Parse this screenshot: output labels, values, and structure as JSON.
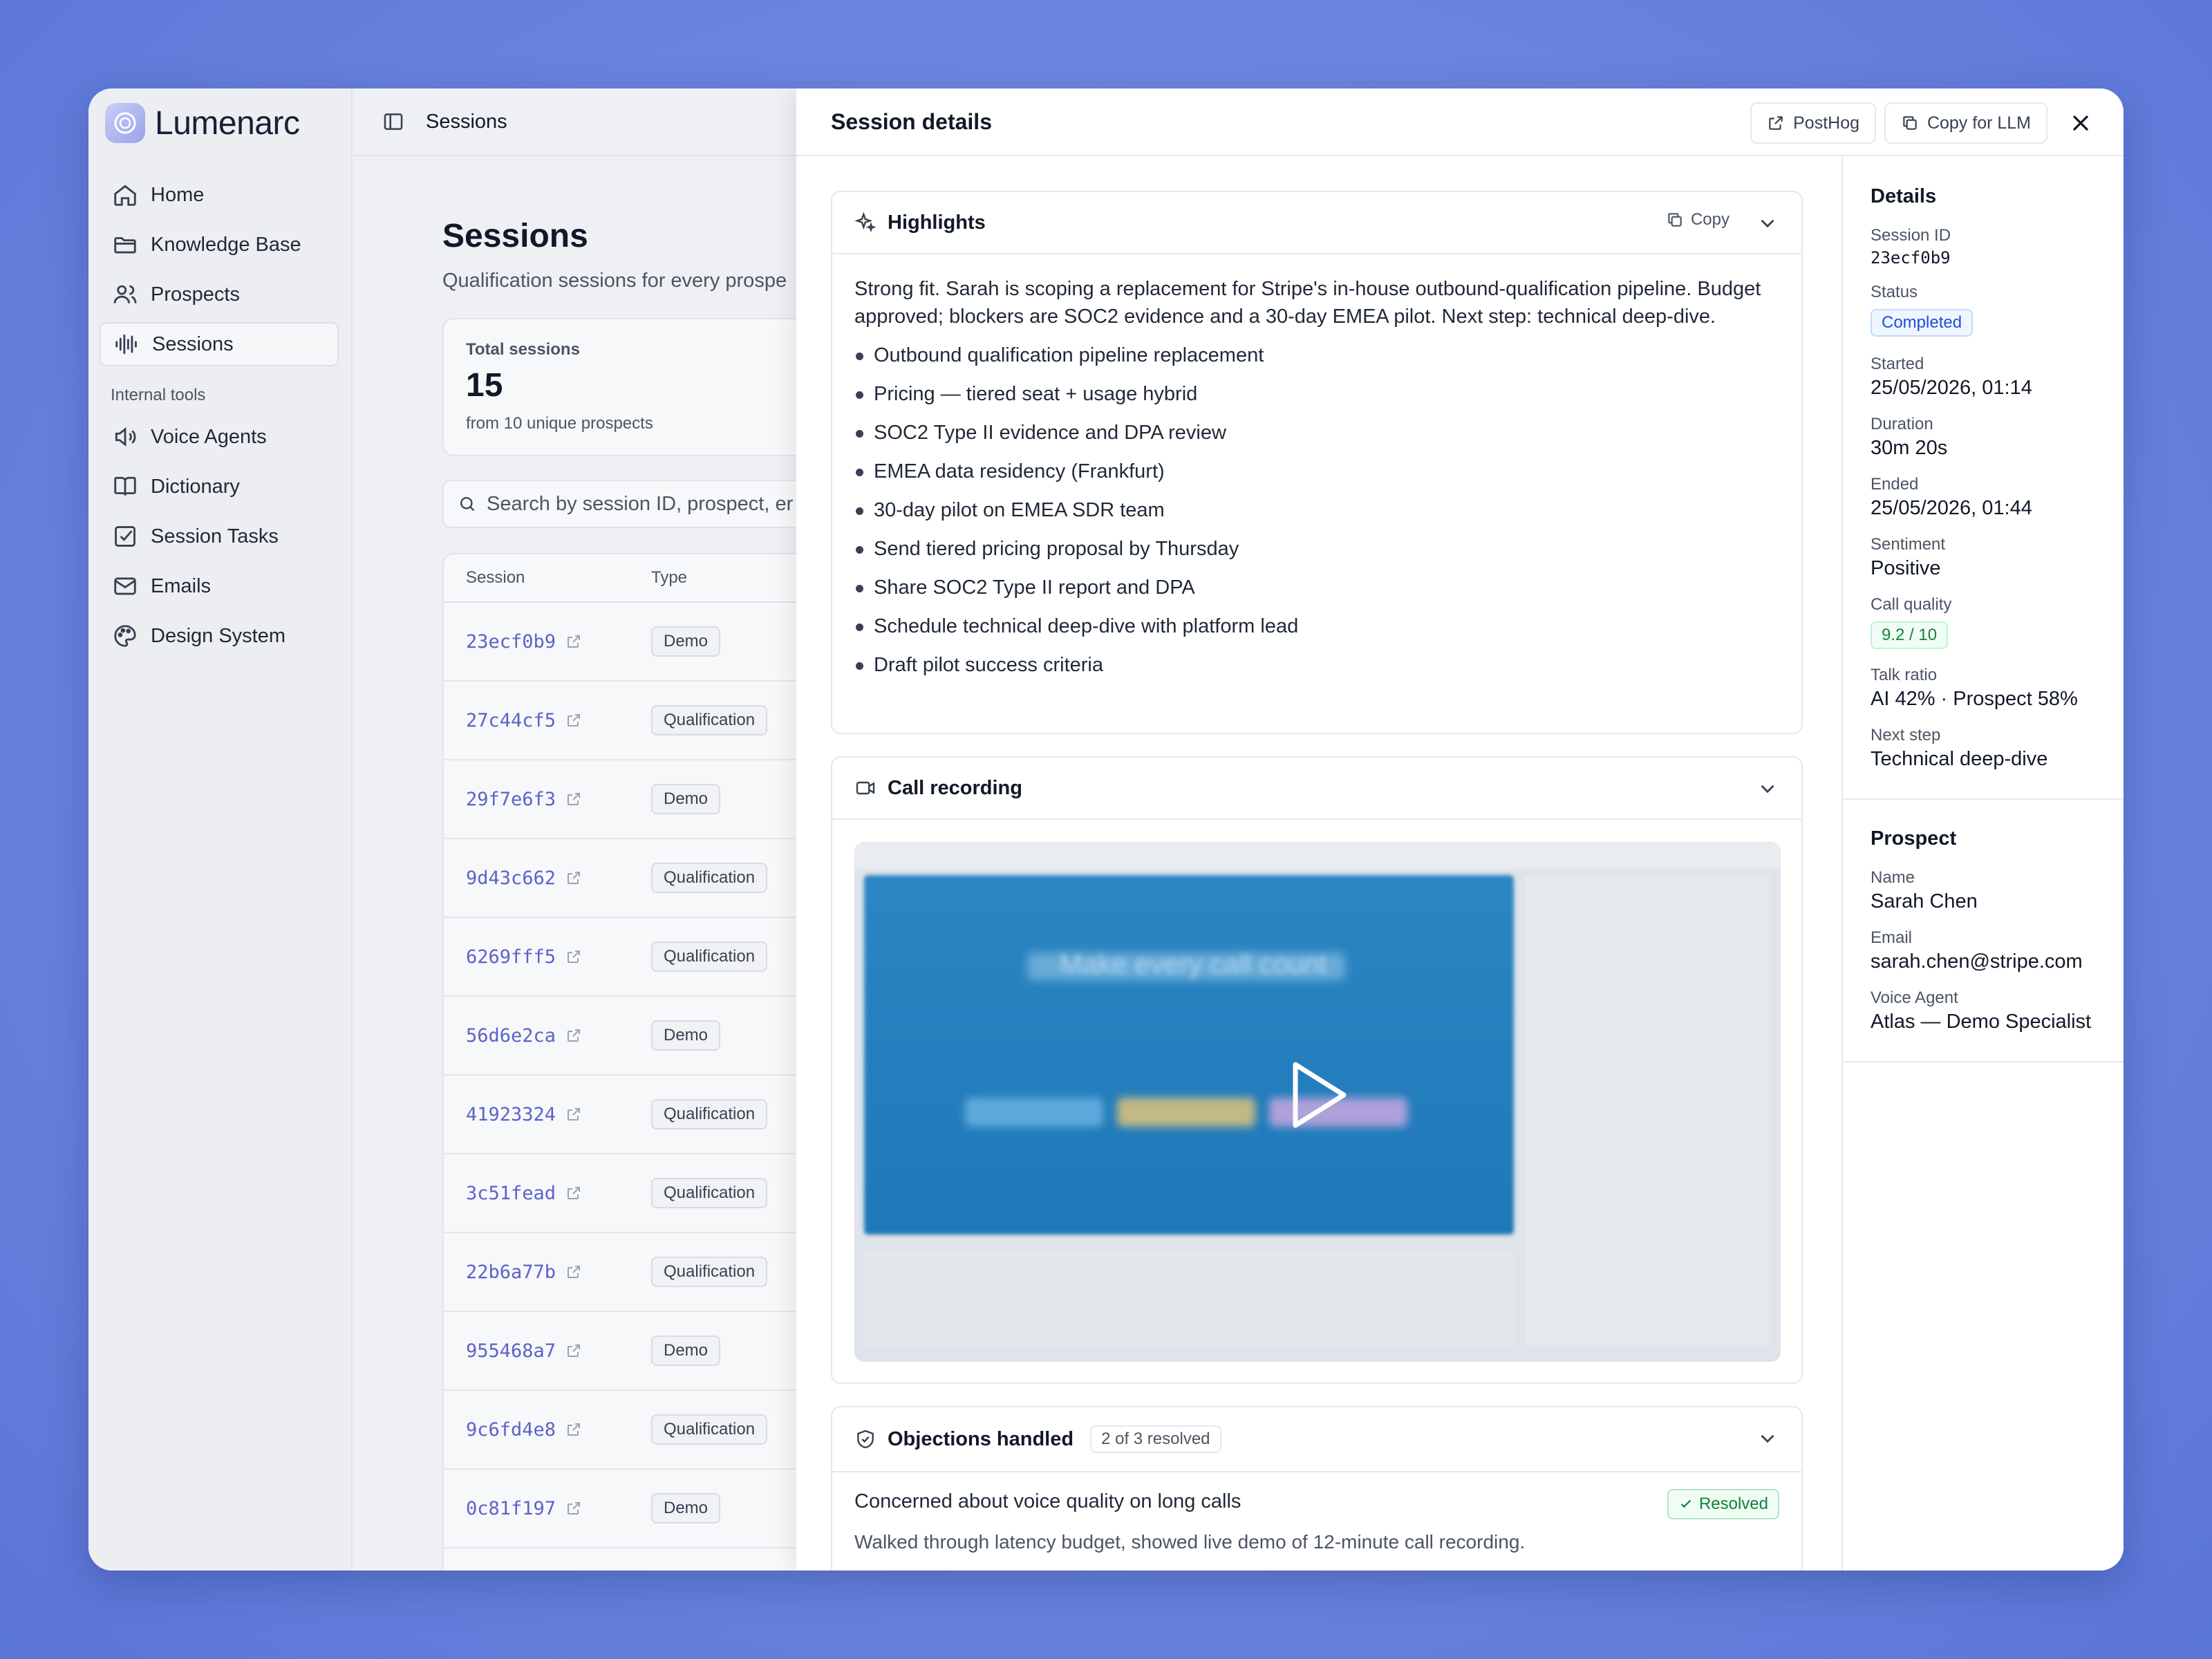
{
  "app": {
    "name": "Lumenarc"
  },
  "sidebar": {
    "items": [
      {
        "label": "Home",
        "icon": "home-icon"
      },
      {
        "label": "Knowledge Base",
        "icon": "folder-icon"
      },
      {
        "label": "Prospects",
        "icon": "users-icon"
      },
      {
        "label": "Sessions",
        "icon": "waveform-icon",
        "active": true
      }
    ],
    "section_label": "Internal tools",
    "tools": [
      {
        "label": "Voice Agents",
        "icon": "speaker-icon"
      },
      {
        "label": "Dictionary",
        "icon": "book-icon"
      },
      {
        "label": "Session Tasks",
        "icon": "checkbox-icon"
      },
      {
        "label": "Emails",
        "icon": "mail-icon"
      },
      {
        "label": "Design System",
        "icon": "palette-icon"
      }
    ]
  },
  "main": {
    "breadcrumb": "Sessions",
    "title": "Sessions",
    "subtitle": "Qualification sessions for every prospe",
    "stat": {
      "label": "Total sessions",
      "value": "15",
      "sub": "from 10 unique prospects"
    },
    "search_placeholder": "Search by session ID, prospect, er",
    "table": {
      "columns": [
        "Session",
        "Type"
      ],
      "rows": [
        {
          "id": "23ecf0b9",
          "type": "Demo"
        },
        {
          "id": "27c44cf5",
          "type": "Qualification"
        },
        {
          "id": "29f7e6f3",
          "type": "Demo"
        },
        {
          "id": "9d43c662",
          "type": "Qualification"
        },
        {
          "id": "6269fff5",
          "type": "Qualification"
        },
        {
          "id": "56d6e2ca",
          "type": "Demo"
        },
        {
          "id": "41923324",
          "type": "Qualification"
        },
        {
          "id": "3c51fead",
          "type": "Qualification"
        },
        {
          "id": "22b6a77b",
          "type": "Qualification"
        },
        {
          "id": "955468a7",
          "type": "Demo"
        },
        {
          "id": "9c6fd4e8",
          "type": "Qualification"
        },
        {
          "id": "0c81f197",
          "type": "Demo"
        }
      ]
    }
  },
  "panel": {
    "title": "Session details",
    "posthog_label": "PostHog",
    "copy_llm_label": "Copy for LLM",
    "highlights": {
      "title": "Highlights",
      "copy_label": "Copy",
      "summary": "Strong fit. Sarah is scoping a replacement for Stripe's in-house outbound-qualification pipeline. Budget approved; blockers are SOC2 evidence and a 30-day EMEA pilot. Next step: technical deep-dive.",
      "bullets": [
        "Outbound qualification pipeline replacement",
        "Pricing — tiered seat + usage hybrid",
        "SOC2 Type II evidence and DPA review",
        "EMEA data residency (Frankfurt)",
        "30-day pilot on EMEA SDR team",
        "Send tiered pricing proposal by Thursday",
        "Share SOC2 Type II report and DPA",
        "Schedule technical deep-dive with platform lead",
        "Draft pilot success criteria"
      ]
    },
    "recording": {
      "title": "Call recording",
      "video_headline": "Make every call count"
    },
    "objections": {
      "title": "Objections handled",
      "count": "2 of 3 resolved",
      "items": [
        {
          "title": "Concerned about voice quality on long calls",
          "status": "Resolved",
          "desc": "Walked through latency budget, showed live demo of 12-minute call recording."
        }
      ]
    }
  },
  "details": {
    "title": "Details",
    "session_id_label": "Session ID",
    "session_id": "23ecf0b9",
    "status_label": "Status",
    "status": "Completed",
    "started_label": "Started",
    "started": "25/05/2026, 01:14",
    "duration_label": "Duration",
    "duration": "30m 20s",
    "ended_label": "Ended",
    "ended": "25/05/2026, 01:44",
    "sentiment_label": "Sentiment",
    "sentiment": "Positive",
    "quality_label": "Call quality",
    "quality": "9.2 / 10",
    "talk_label": "Talk ratio",
    "talk": "AI 42% · Prospect 58%",
    "next_label": "Next step",
    "next": "Technical deep-dive"
  },
  "prospect": {
    "title": "Prospect",
    "name_label": "Name",
    "name": "Sarah Chen",
    "email_label": "Email",
    "email": "sarah.chen@stripe.com",
    "agent_label": "Voice Agent",
    "agent": "Atlas — Demo Specialist"
  },
  "colors": {
    "accent": "#5a63c7",
    "resolved": "#15803d",
    "status_blue": "#1d4ed8"
  }
}
